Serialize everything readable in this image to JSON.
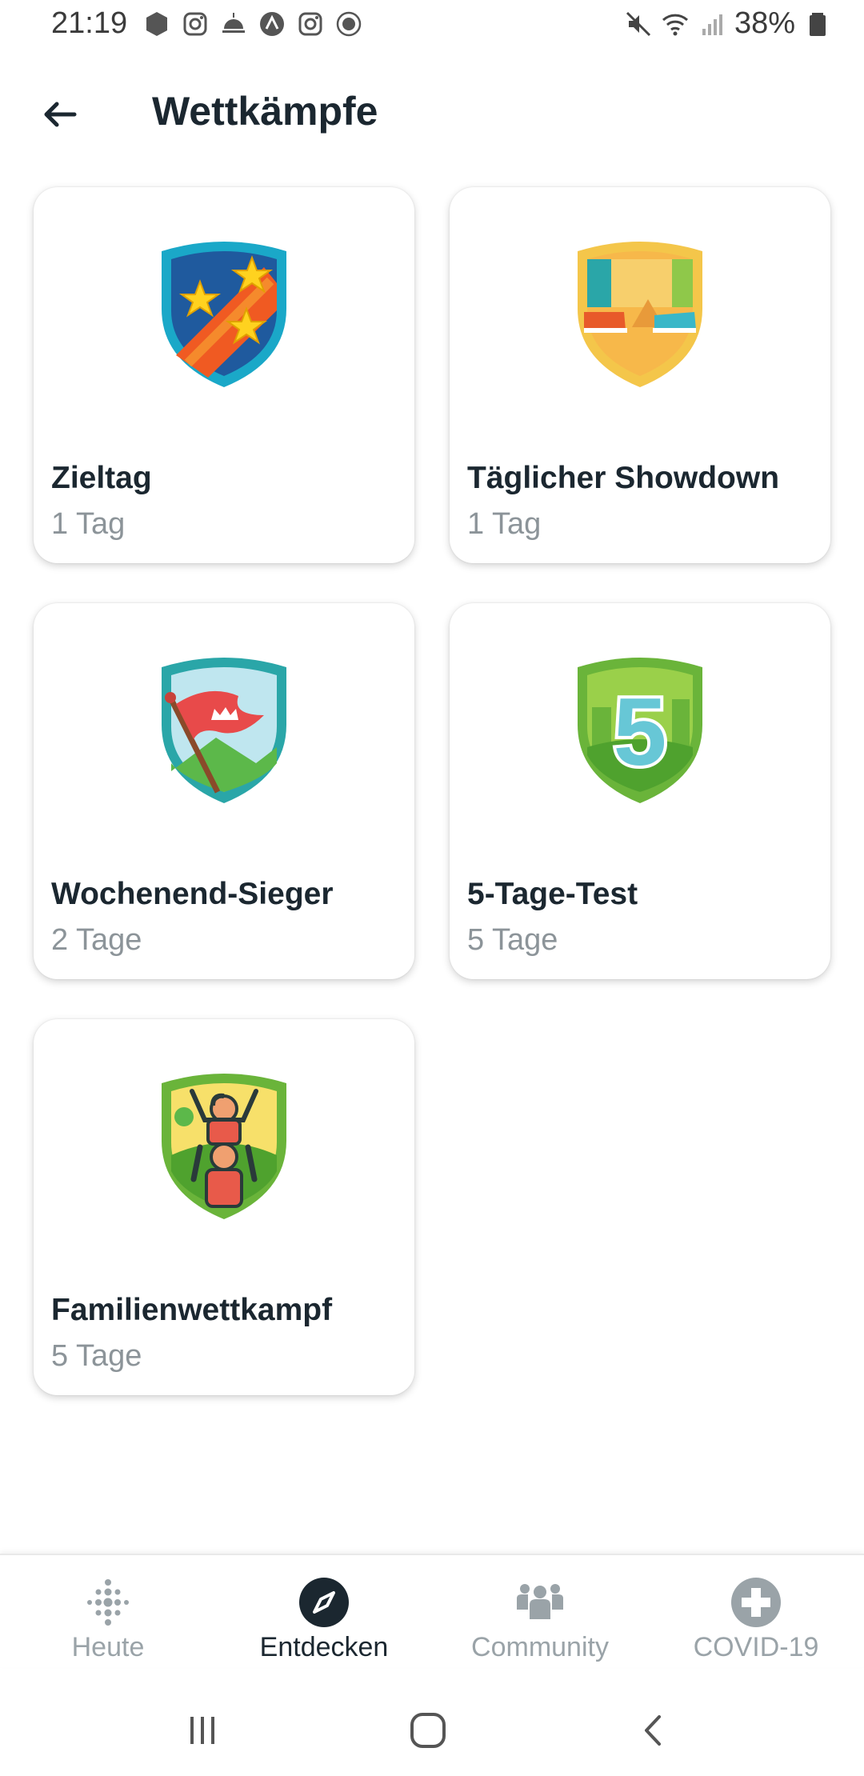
{
  "status_bar": {
    "time": "21:19",
    "battery": "38%",
    "left_icons": [
      "hexagon-icon",
      "instagram-icon",
      "weather-icon",
      "strava-icon",
      "instagram-icon",
      "bvb-icon"
    ],
    "right_icons": [
      "mute-icon",
      "wifi-icon",
      "signal-icon",
      "battery-icon"
    ]
  },
  "header": {
    "title": "Wettkämpfe"
  },
  "challenges": [
    {
      "title": "Zieltag",
      "duration": "1 Tag",
      "badge": "stars-badge-icon"
    },
    {
      "title": "Täglicher Showdown",
      "duration": "1 Tag",
      "badge": "sneakers-badge-icon"
    },
    {
      "title": "Wochenend-Sieger",
      "duration": "2 Tage",
      "badge": "flag-badge-icon"
    },
    {
      "title": "5-Tage-Test",
      "duration": "5 Tage",
      "badge": "five-badge-icon"
    },
    {
      "title": "Familienwettkampf",
      "duration": "5 Tage",
      "badge": "family-badge-icon"
    }
  ],
  "bottom_nav": [
    {
      "label": "Heute",
      "icon": "fitbit-dots-icon",
      "active": false
    },
    {
      "label": "Entdecken",
      "icon": "compass-icon",
      "active": true
    },
    {
      "label": "Community",
      "icon": "people-icon",
      "active": false
    },
    {
      "label": "COVID-19",
      "icon": "plus-cross-icon",
      "active": false
    }
  ],
  "colors": {
    "text": "#1b2730",
    "secondary": "#8c9499",
    "nav_inactive": "#9aa3a8"
  }
}
